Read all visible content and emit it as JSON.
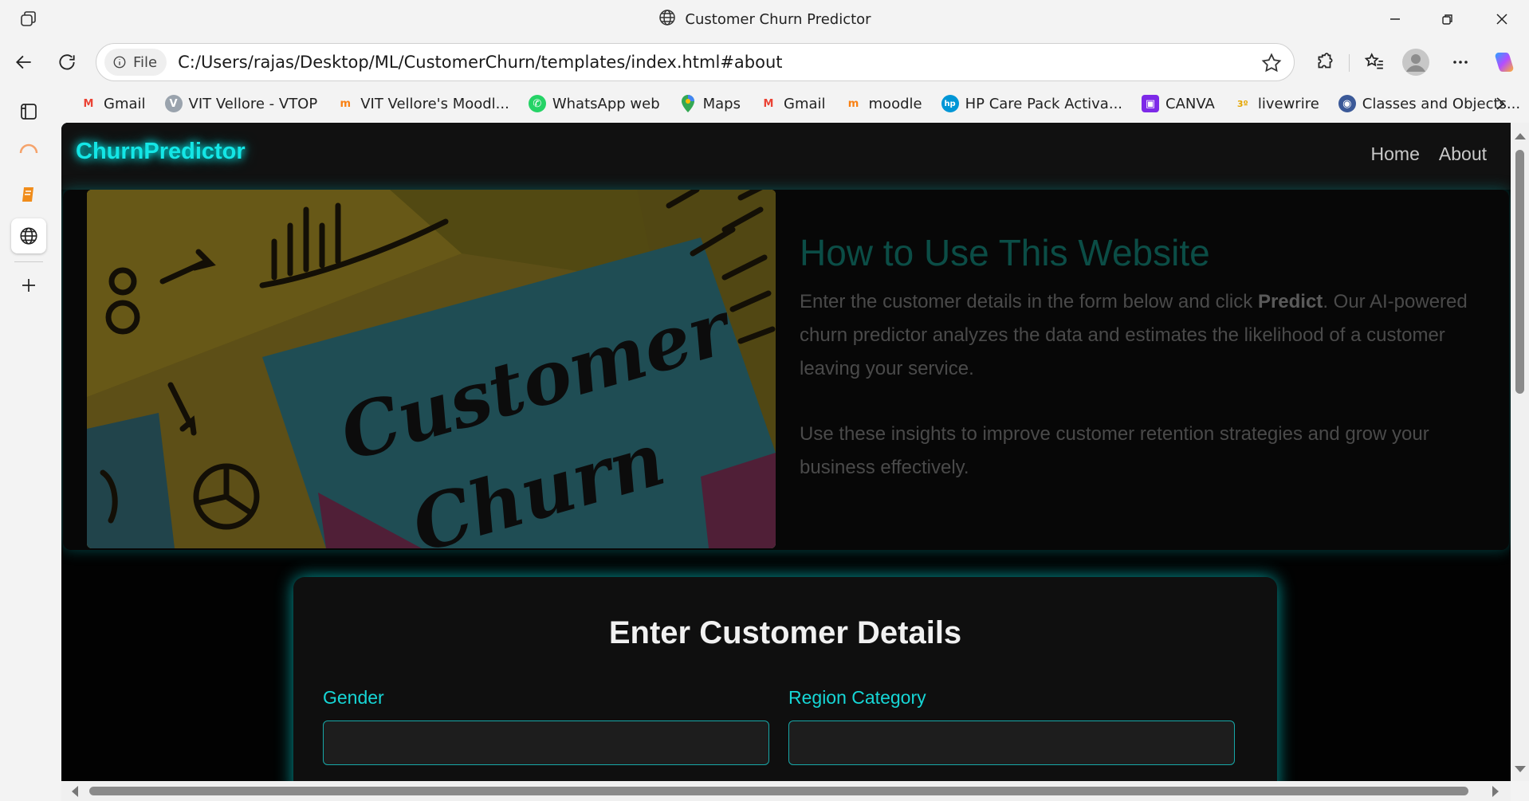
{
  "window": {
    "title": "Customer Churn Predictor"
  },
  "address_bar": {
    "scheme_label": "File",
    "url": "C:/Users/rajas/Desktop/ML/CustomerChurn/templates/index.html#about"
  },
  "bookmarks": [
    {
      "label": "Gmail",
      "icon": "gmail-icon",
      "color": "#ea4335"
    },
    {
      "label": "VIT Vellore - VTOP",
      "icon": "vtop-icon",
      "color": "#6b7280"
    },
    {
      "label": "VIT Vellore's Moodl...",
      "icon": "moodle-icon",
      "color": "#f98012"
    },
    {
      "label": "WhatsApp web",
      "icon": "whatsapp-icon",
      "color": "#25d366"
    },
    {
      "label": "Maps",
      "icon": "maps-icon",
      "color": "#34a853"
    },
    {
      "label": "Gmail",
      "icon": "gmail-icon",
      "color": "#ea4335"
    },
    {
      "label": "moodle",
      "icon": "moodle-icon",
      "color": "#f98012"
    },
    {
      "label": "HP Care Pack Activa...",
      "icon": "hp-icon",
      "color": "#0096d6"
    },
    {
      "label": "CANVA",
      "icon": "canva-icon",
      "color": "#7d2ae8"
    },
    {
      "label": "livewrire",
      "icon": "livewire-icon",
      "color": "#e5a600"
    },
    {
      "label": "Classes and Objects...",
      "icon": "classes-icon",
      "color": "#3b5998"
    }
  ],
  "site": {
    "brand": "ChurnPredictor",
    "nav": {
      "home": "Home",
      "about": "About"
    },
    "about": {
      "title": "How to Use This Website",
      "p1_before": "Enter the customer details in the form below and click ",
      "p1_bold": "Predict",
      "p1_after": ". Our AI-powered churn predictor analyzes the data and estimates the likelihood of a customer leaving your service.",
      "p2": "Use these insights to improve customer retention strategies and grow your business effectively.",
      "image_text_line1": "Customer",
      "image_text_line2": "Churn"
    },
    "form": {
      "title": "Enter Customer Details",
      "gender_label": "Gender",
      "region_label": "Region Category",
      "gender_value": "",
      "region_value": ""
    }
  },
  "colors": {
    "accent": "#14e6e6",
    "about_title": "#0b4d46",
    "page_bg": "#020202"
  }
}
